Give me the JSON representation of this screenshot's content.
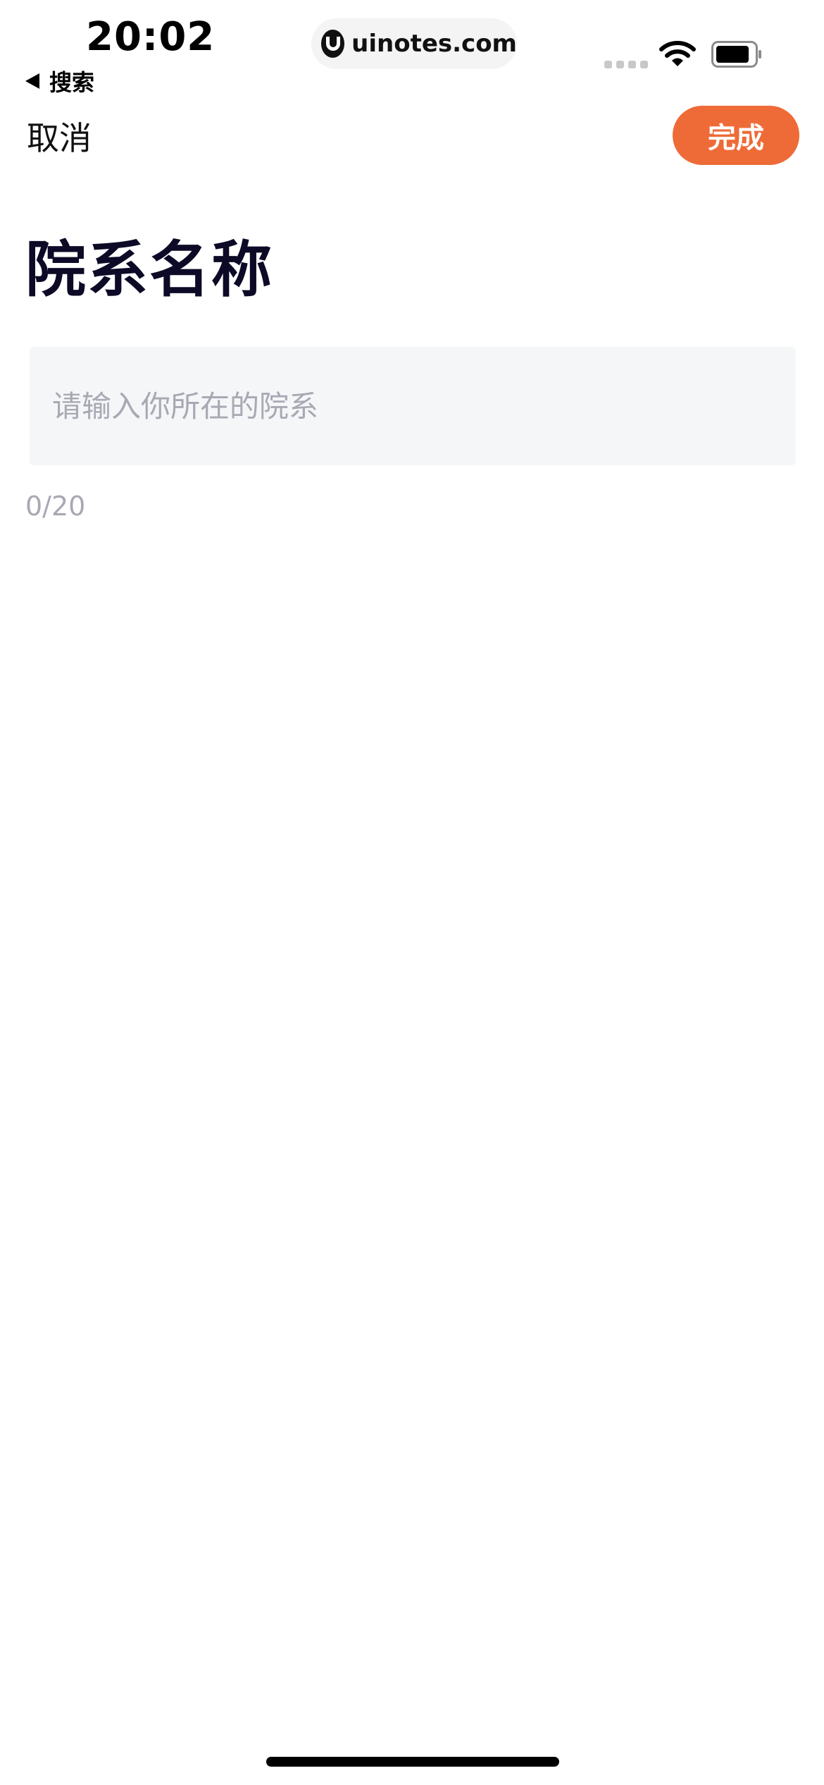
{
  "status_bar": {
    "time": "20:02",
    "back_label": "搜索",
    "url": "uinotes.com"
  },
  "nav": {
    "cancel_label": "取消",
    "done_label": "完成"
  },
  "form": {
    "title": "院系名称",
    "input_value": "",
    "input_placeholder": "请输入你所在的院系",
    "counter": "0/20"
  },
  "colors": {
    "accent": "#ee6b37",
    "title": "#0c0a26",
    "input_bg": "#f5f6f8",
    "placeholder": "#a8a9b3"
  },
  "icons": {
    "back": "back-triangle-icon",
    "url_logo": "site-logo-icon",
    "signal": "cellular-signal-icon",
    "wifi": "wifi-icon",
    "battery": "battery-icon"
  }
}
